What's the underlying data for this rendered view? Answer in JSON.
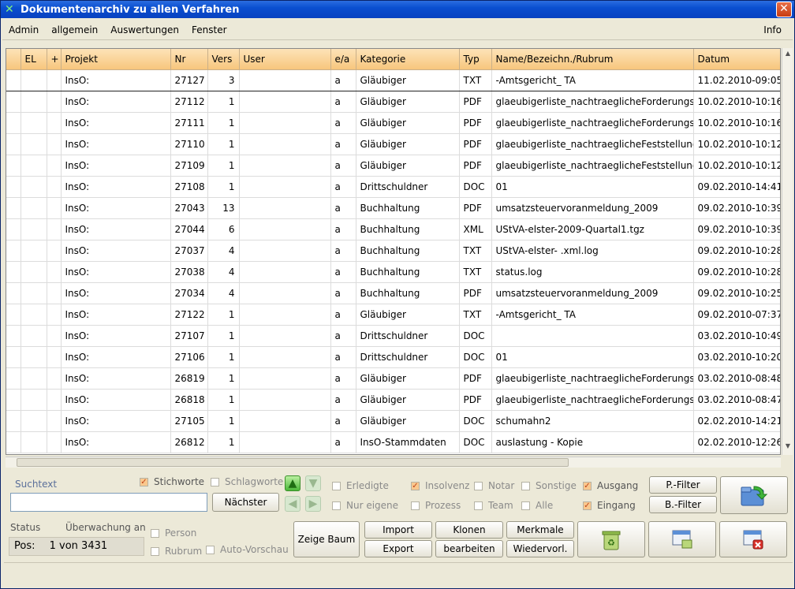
{
  "window": {
    "title": "Dokumentenarchiv zu allen Verfahren",
    "close_glyph": "✕"
  },
  "menu": {
    "items": [
      "Admin",
      "allgemein",
      "Auswertungen",
      "Fenster"
    ],
    "info": "Info"
  },
  "columns": [
    "",
    "EL",
    "+",
    "Projekt",
    "Nr",
    "Vers",
    "User",
    "e/a",
    "Kategorie",
    "Typ",
    "Name/Bezeichn./Rubrum",
    "Datum"
  ],
  "rows": [
    {
      "projekt": "InsO:",
      "nr": "27127",
      "vers": "3",
      "ea": "a",
      "kategorie": "Gläubiger",
      "typ": "TXT",
      "name": "-Amtsgericht_ TA",
      "datum": "11.02.2010-09:05"
    },
    {
      "projekt": "InsO:",
      "nr": "27112",
      "vers": "1",
      "ea": "a",
      "kategorie": "Gläubiger",
      "typ": "PDF",
      "name": "glaeubigerliste_nachtraeglicheForderungsk",
      "datum": "10.02.2010-10:16"
    },
    {
      "projekt": "InsO:",
      "nr": "27111",
      "vers": "1",
      "ea": "a",
      "kategorie": "Gläubiger",
      "typ": "PDF",
      "name": "glaeubigerliste_nachtraeglicheForderungsk",
      "datum": "10.02.2010-10:16"
    },
    {
      "projekt": "InsO:",
      "nr": "27110",
      "vers": "1",
      "ea": "a",
      "kategorie": "Gläubiger",
      "typ": "PDF",
      "name": "glaeubigerliste_nachtraeglicheFeststellung_",
      "datum": "10.02.2010-10:12"
    },
    {
      "projekt": "InsO:",
      "nr": "27109",
      "vers": "1",
      "ea": "a",
      "kategorie": "Gläubiger",
      "typ": "PDF",
      "name": "glaeubigerliste_nachtraeglicheFeststellung_",
      "datum": "10.02.2010-10:12"
    },
    {
      "projekt": "InsO:",
      "nr": "27108",
      "vers": "1",
      "ea": "a",
      "kategorie": "Drittschuldner",
      "typ": "DOC",
      "name": "01",
      "datum": "09.02.2010-14:41"
    },
    {
      "projekt": "InsO:",
      "nr": "27043",
      "vers": "13",
      "ea": "a",
      "kategorie": "Buchhaltung",
      "typ": "PDF",
      "name": "umsatzsteuervoranmeldung_2009",
      "datum": "09.02.2010-10:39"
    },
    {
      "projekt": "InsO:",
      "nr": "27044",
      "vers": "6",
      "ea": "a",
      "kategorie": "Buchhaltung",
      "typ": "XML",
      "name": "UStVA-elster-2009-Quartal1.tgz",
      "datum": "09.02.2010-10:39"
    },
    {
      "projekt": "InsO:",
      "nr": "27037",
      "vers": "4",
      "ea": "a",
      "kategorie": "Buchhaltung",
      "typ": "TXT",
      "name": "UStVA-elster- .xml.log",
      "datum": "09.02.2010-10:28"
    },
    {
      "projekt": "InsO:",
      "nr": "27038",
      "vers": "4",
      "ea": "a",
      "kategorie": "Buchhaltung",
      "typ": "TXT",
      "name": "status.log",
      "datum": "09.02.2010-10:28"
    },
    {
      "projekt": "InsO:",
      "nr": "27034",
      "vers": "4",
      "ea": "a",
      "kategorie": "Buchhaltung",
      "typ": "PDF",
      "name": "umsatzsteuervoranmeldung_2009",
      "datum": "09.02.2010-10:25"
    },
    {
      "projekt": "InsO:",
      "nr": "27122",
      "vers": "1",
      "ea": "a",
      "kategorie": "Gläubiger",
      "typ": "TXT",
      "name": "-Amtsgericht_ TA",
      "datum": "09.02.2010-07:37"
    },
    {
      "projekt": "InsO:",
      "nr": "27107",
      "vers": "1",
      "ea": "a",
      "kategorie": "Drittschuldner",
      "typ": "DOC",
      "name": "",
      "datum": "03.02.2010-10:49"
    },
    {
      "projekt": "InsO:",
      "nr": "27106",
      "vers": "1",
      "ea": "a",
      "kategorie": "Drittschuldner",
      "typ": "DOC",
      "name": "01",
      "datum": "03.02.2010-10:20"
    },
    {
      "projekt": "InsO:",
      "nr": "26819",
      "vers": "1",
      "ea": "a",
      "kategorie": "Gläubiger",
      "typ": "PDF",
      "name": "glaeubigerliste_nachtraeglicheForderungsk",
      "datum": "03.02.2010-08:48"
    },
    {
      "projekt": "InsO:",
      "nr": "26818",
      "vers": "1",
      "ea": "a",
      "kategorie": "Gläubiger",
      "typ": "PDF",
      "name": "glaeubigerliste_nachtraeglicheForderungsk",
      "datum": "03.02.2010-08:47"
    },
    {
      "projekt": "InsO:",
      "nr": "27105",
      "vers": "1",
      "ea": "a",
      "kategorie": "Gläubiger",
      "typ": "DOC",
      "name": "schumahn2",
      "datum": "02.02.2010-14:21"
    },
    {
      "projekt": "InsO:",
      "nr": "26812",
      "vers": "1",
      "ea": "a",
      "kategorie": "InsO-Stammdaten",
      "typ": "DOC",
      "name": "auslastung - Kopie",
      "datum": "02.02.2010-12:26"
    }
  ],
  "search": {
    "label": "Suchtext",
    "value": "",
    "next_button": "Nächster"
  },
  "filters": {
    "stichworte": {
      "label": "Stichworte",
      "checked": true
    },
    "schlagworte": {
      "label": "Schlagworte",
      "checked": false
    },
    "erledigte": {
      "label": "Erledigte",
      "checked": false
    },
    "nur_eigene": {
      "label": "Nur eigene",
      "checked": false
    },
    "insolvenz": {
      "label": "Insolvenz",
      "checked": true
    },
    "prozess": {
      "label": "Prozess",
      "checked": false
    },
    "notar": {
      "label": "Notar",
      "checked": false
    },
    "team": {
      "label": "Team",
      "checked": false
    },
    "sonstige": {
      "label": "Sonstige",
      "checked": false
    },
    "alle": {
      "label": "Alle",
      "checked": false
    },
    "ausgang": {
      "label": "Ausgang",
      "checked": true
    },
    "eingang": {
      "label": "Eingang",
      "checked": true
    }
  },
  "filter_buttons": {
    "p_filter": "P.-Filter",
    "b_filter": "B.-Filter"
  },
  "status": {
    "label": "Status",
    "watch_label": "Überwachung an",
    "pos_label": "Pos:",
    "pos_value": "1 von 3431"
  },
  "options": {
    "person": {
      "label": "Person",
      "checked": false
    },
    "rubrum": {
      "label": "Rubrum",
      "checked": false
    },
    "auto_vorschau": {
      "label": "Auto-Vorschau",
      "checked": false
    }
  },
  "actions": {
    "zeige_baum": "Zeige Baum",
    "import": "Import",
    "export": "Export",
    "klonen": "Klonen",
    "bearbeiten": "bearbeiten",
    "merkmale": "Merkmale",
    "wiedervorl": "Wiedervorl."
  },
  "colors": {
    "header_bg": "#f7c67d",
    "titlebar": "#0a4fd0",
    "check": "#c0451a"
  }
}
